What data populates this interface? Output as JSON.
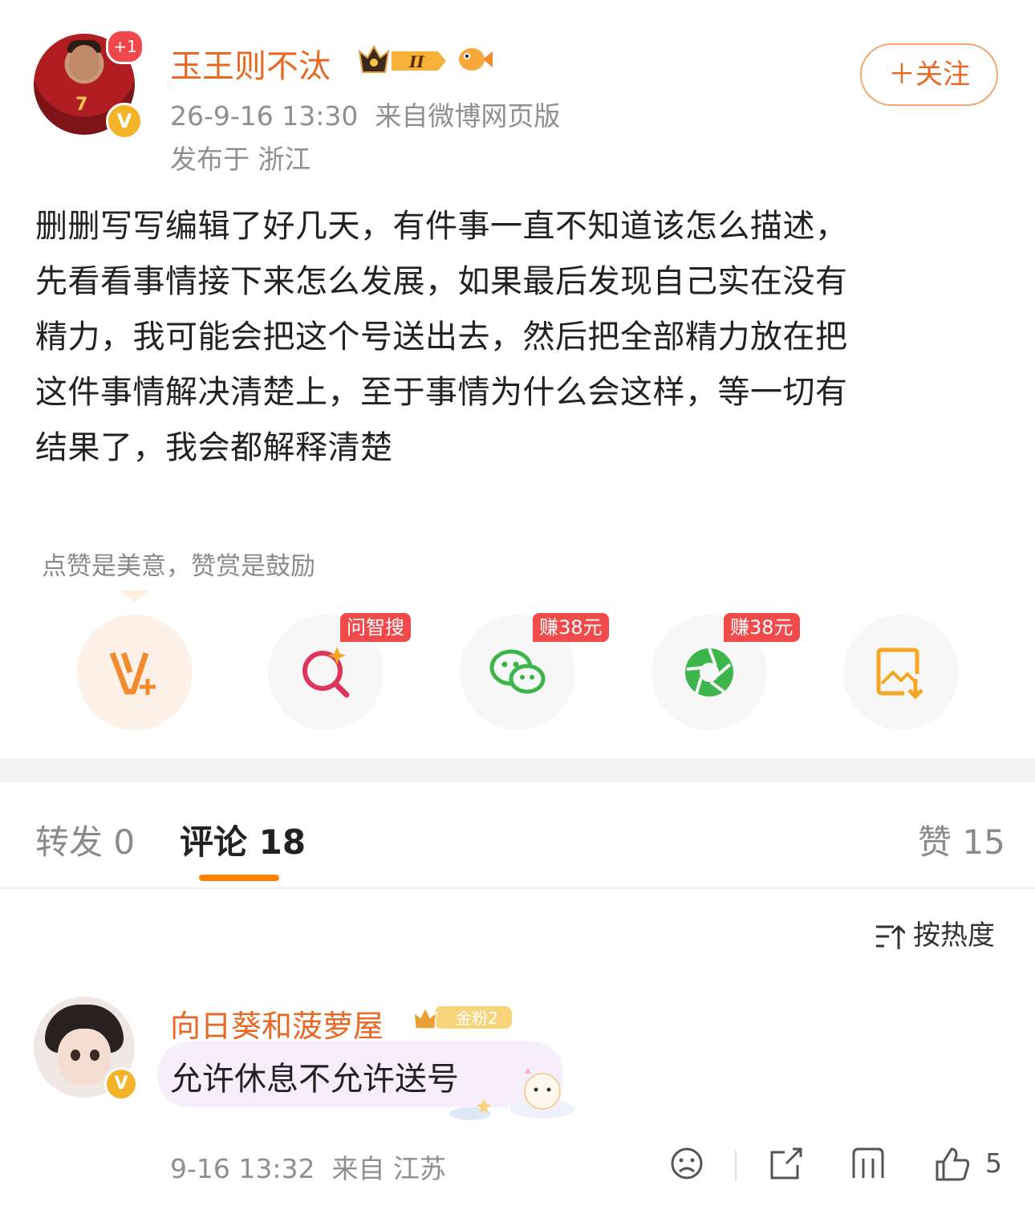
{
  "post": {
    "author": {
      "name": "玉王则不汰",
      "notification_badge": "+1",
      "verified_mark": "V",
      "level_badge": "II",
      "follow_label": "＋关注"
    },
    "time": "26-9-16 13:30",
    "source": "来自微博网页版",
    "location": "发布于 浙江",
    "text_lines": [
      "删删写写编辑了好几天，有件事一直不知道该怎么描述，",
      "先看看事情接下来怎么发展，如果最后发现自己实在没有",
      "精力，我可能会把这个号送出去，然后把全部精力放在把",
      "这件事情解决清楚上，至于事情为什么会这样，等一切有",
      "结果了，我会都解释清楚"
    ],
    "reward_hint": "点赞是美意，赞赏是鼓励"
  },
  "actions": [
    {
      "icon": "reward-v-plus-icon",
      "tag": ""
    },
    {
      "icon": "ai-search-icon",
      "tag": "问智搜"
    },
    {
      "icon": "wechat-icon",
      "tag": "赚38元"
    },
    {
      "icon": "moments-icon",
      "tag": "赚38元"
    },
    {
      "icon": "save-image-icon",
      "tag": ""
    }
  ],
  "tabs": {
    "repost": "转发 0",
    "comment": "评论 18",
    "like": "赞 15"
  },
  "sort_label": "按热度",
  "comment": {
    "name": "向日葵和菠萝屋",
    "fan_badge": "金粉2",
    "verified_mark": "V",
    "text": "允许休息不允许送号",
    "time": "9-16 13:32",
    "location": "来自 江苏",
    "like_count": "5"
  },
  "colors": {
    "accent": "#e86722",
    "tab_underline": "#ff8200",
    "tag_red": "#f04a4b",
    "verified_gold": "#f4b329",
    "wechat_green": "#3cb54a"
  }
}
